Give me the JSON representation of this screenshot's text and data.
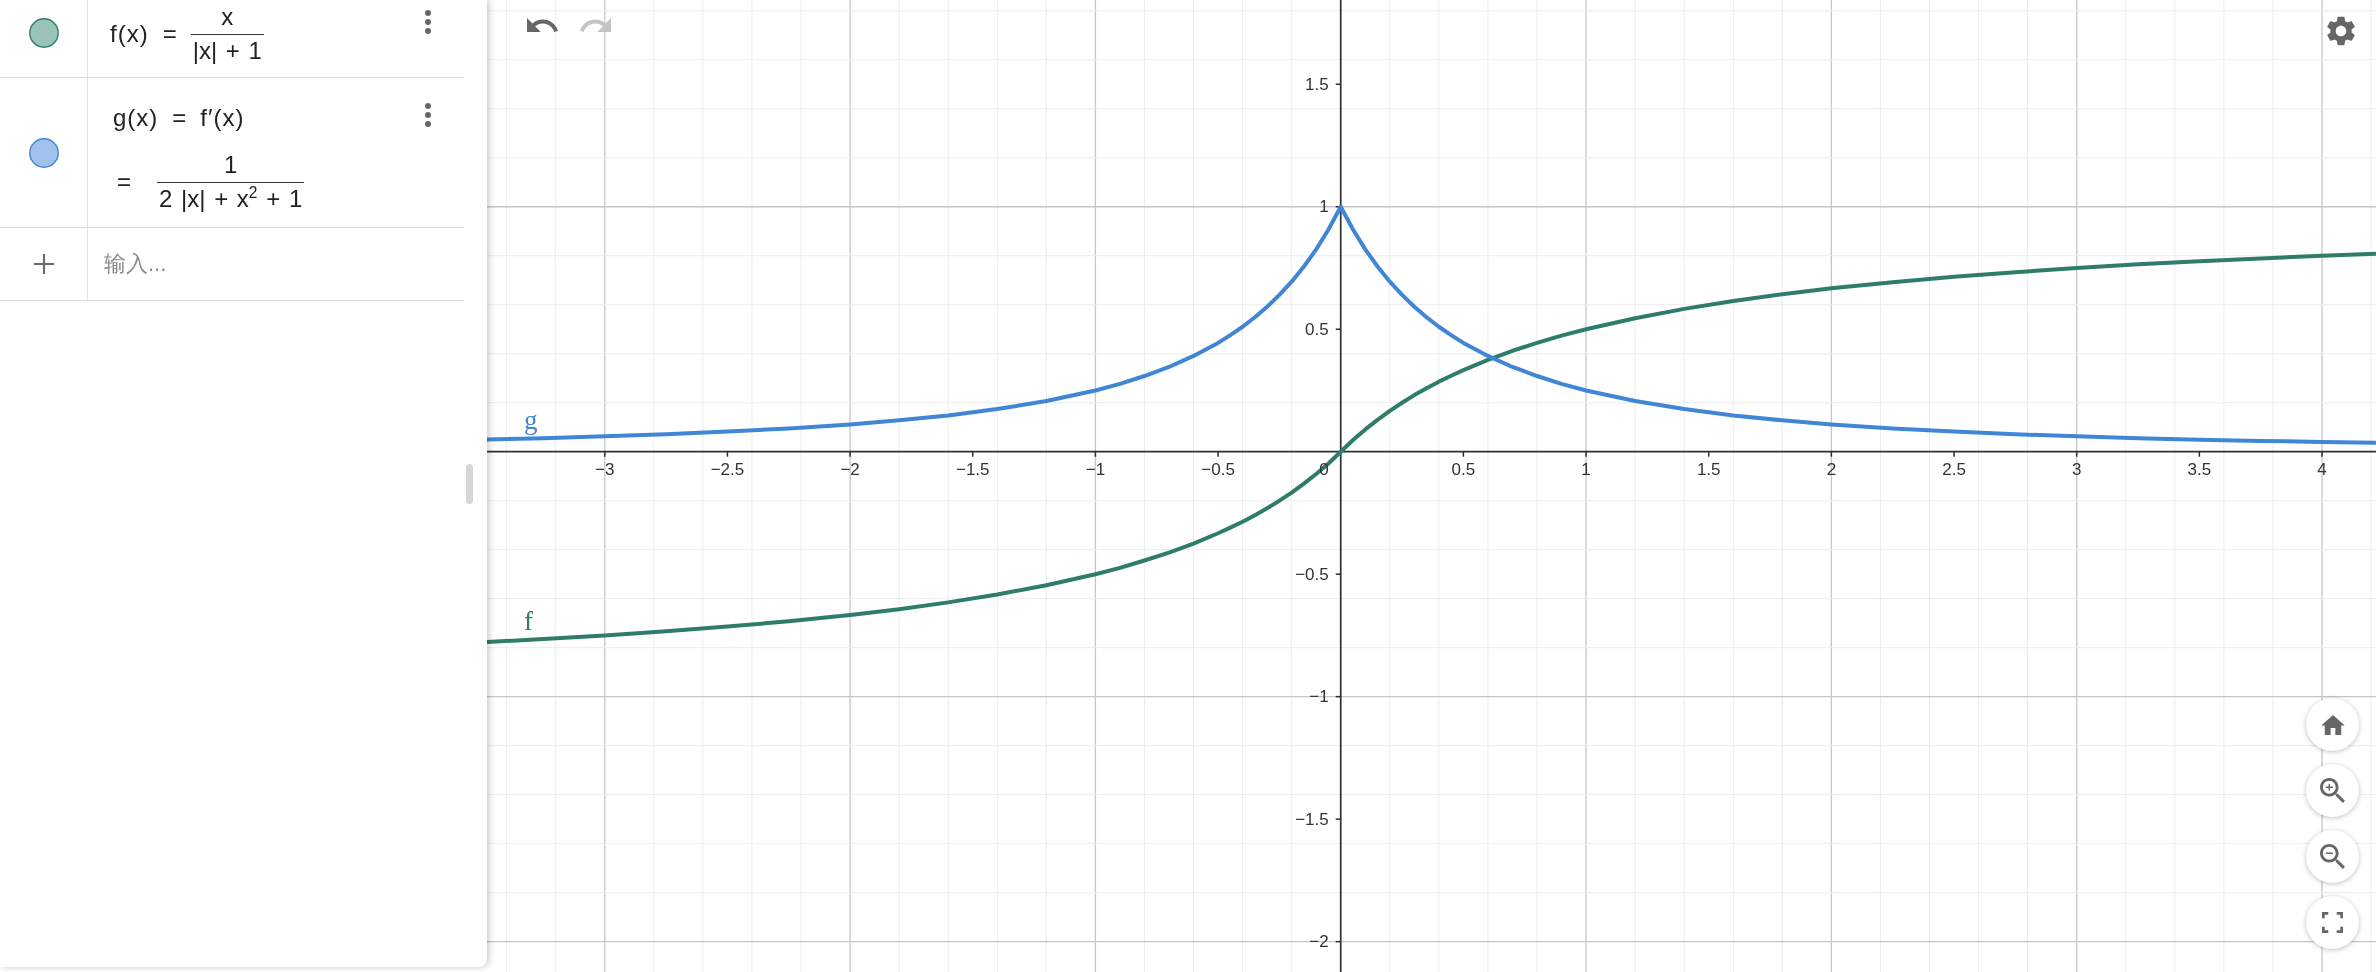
{
  "algebra_view": {
    "items": [
      {
        "color": "#9bc4b8",
        "definition": {
          "lhs": "f(x)",
          "equals": "=",
          "numerator": "x",
          "denominator": "|x| + 1"
        }
      },
      {
        "color": "#a3c2eb",
        "definition": {
          "lhs": "g(x)",
          "equals": "=",
          "rhs": "f′(x)"
        },
        "output": {
          "equals": "=",
          "numerator": "1",
          "denominator": "2 |x| + x$^{2}$ + 1"
        }
      }
    ],
    "input": {
      "placeholder": "输入..."
    }
  },
  "toolbar": [
    {
      "kind": "undo",
      "disabled": false
    },
    {
      "kind": "redo",
      "disabled": true
    }
  ],
  "graph": {
    "origin_label": "0",
    "chart_data": {
      "type": "line",
      "grid": true,
      "x": [
        -3.48,
        -3.25,
        -3,
        -2.75,
        -2.5,
        -2.25,
        -2,
        -1.8,
        -1.6,
        -1.4,
        -1.2,
        -1,
        -0.9,
        -0.8,
        -0.7,
        -0.6,
        -0.5,
        -0.45,
        -0.4,
        -0.35,
        -0.3,
        -0.25,
        -0.2,
        -0.15,
        -0.1,
        -0.05,
        0,
        0.05,
        0.1,
        0.15,
        0.2,
        0.25,
        0.3,
        0.35,
        0.4,
        0.45,
        0.5,
        0.6,
        0.7,
        0.8,
        0.9,
        1,
        1.2,
        1.4,
        1.6,
        1.8,
        2,
        2.25,
        2.5,
        2.75,
        3,
        3.25,
        3.5,
        3.75,
        4,
        4.22
      ],
      "series": [
        {
          "name": "f",
          "color": "#2e7d6a",
          "values": [
            -0.777,
            -0.765,
            -0.75,
            -0.733,
            -0.714,
            -0.692,
            -0.667,
            -0.643,
            -0.615,
            -0.583,
            -0.545,
            -0.5,
            -0.474,
            -0.444,
            -0.412,
            -0.375,
            -0.333,
            -0.31,
            -0.286,
            -0.259,
            -0.231,
            -0.2,
            -0.167,
            -0.13,
            -0.091,
            -0.048,
            0,
            0.048,
            0.091,
            0.13,
            0.167,
            0.2,
            0.231,
            0.259,
            0.286,
            0.31,
            0.333,
            0.375,
            0.412,
            0.444,
            0.474,
            0.5,
            0.545,
            0.583,
            0.615,
            0.643,
            0.667,
            0.692,
            0.714,
            0.733,
            0.75,
            0.765,
            0.778,
            0.789,
            0.8,
            0.808
          ]
        },
        {
          "name": "g",
          "color": "#4086d4",
          "values": [
            0.05,
            0.055,
            0.063,
            0.071,
            0.082,
            0.095,
            0.111,
            0.128,
            0.148,
            0.174,
            0.207,
            0.25,
            0.277,
            0.309,
            0.346,
            0.391,
            0.444,
            0.476,
            0.51,
            0.549,
            0.592,
            0.64,
            0.694,
            0.756,
            0.826,
            0.907,
            1,
            0.907,
            0.826,
            0.756,
            0.694,
            0.64,
            0.592,
            0.549,
            0.51,
            0.476,
            0.444,
            0.391,
            0.346,
            0.309,
            0.277,
            0.25,
            0.207,
            0.174,
            0.148,
            0.128,
            0.111,
            0.095,
            0.082,
            0.071,
            0.063,
            0.055,
            0.049,
            0.044,
            0.04,
            0.037
          ]
        }
      ],
      "xlim": [
        -3.48,
        4.22
      ],
      "ylim": [
        -2.124,
        1.844
      ],
      "xticks": [
        {
          "value": -3,
          "label": "−3"
        },
        {
          "value": -2.5,
          "label": "−2.5"
        },
        {
          "value": -2,
          "label": "−2"
        },
        {
          "value": -1.5,
          "label": "−1.5"
        },
        {
          "value": -1,
          "label": "−1"
        },
        {
          "value": -0.5,
          "label": "−0.5"
        },
        0.5,
        1,
        1.5,
        2,
        2.5,
        3,
        3.5,
        4
      ],
      "yticks": [
        {
          "value": -2,
          "label": "−2"
        },
        {
          "value": -1.5,
          "label": "−1.5"
        },
        {
          "value": -1,
          "label": "−1"
        },
        {
          "value": -0.5,
          "label": "−0.5"
        },
        0.5,
        1,
        1.5
      ]
    }
  },
  "view_buttons": [
    {
      "kind": "home"
    },
    {
      "kind": "zoom_in"
    },
    {
      "kind": "zoom_out"
    },
    {
      "kind": "fullscreen"
    }
  ]
}
